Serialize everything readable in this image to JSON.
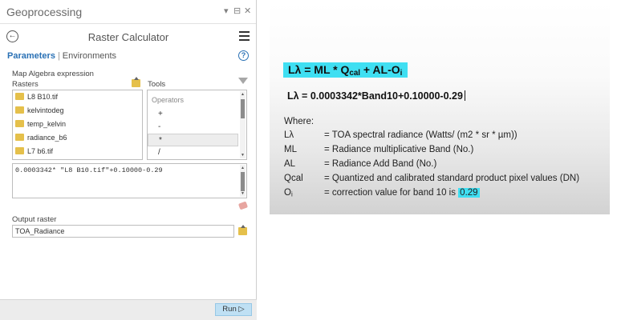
{
  "pane": {
    "title": "Geoprocessing",
    "header_icons": [
      "dropdown-icon",
      "pin-icon",
      "close-icon"
    ],
    "pin_glyph": "▾",
    "dock_glyph": "⊟",
    "close_glyph": "✕"
  },
  "tool": {
    "title": "Raster Calculator",
    "back_glyph": "←"
  },
  "tabs": {
    "parameters": "Parameters",
    "separator": "|",
    "environments": "Environments",
    "help_glyph": "?"
  },
  "map_algebra": {
    "section_label": "Map Algebra expression",
    "rasters_label": "Rasters",
    "tools_label": "Tools",
    "rasters": [
      "L8 B10.tif",
      "kelvintodeg",
      "temp_kelvin",
      "radiance_b6",
      "L7 b6.tif"
    ],
    "operators_label": "Operators",
    "operators": [
      "+",
      "-",
      "*",
      "/"
    ],
    "selected_operator": "*",
    "expression": "0.0003342* \"L8 B10.tif\"+0.10000-0.29"
  },
  "output": {
    "label": "Output raster",
    "value": "TOA_Radiance"
  },
  "run_label": "Run",
  "run_glyph": "▷",
  "formula": {
    "title": {
      "lhs": "Lλ = ML * Q",
      "sub": "cal",
      "rhs": " + AL-O",
      "rhs_sub": "i"
    },
    "main": "Lλ = 0.0003342*Band10+0.10000-0.29",
    "where": "Where:",
    "terms": [
      {
        "term": "Lλ",
        "desc": "= TOA spectral radiance (Watts/ (m2 * sr * µm))"
      },
      {
        "term": "ML",
        "desc": "= Radiance multiplicative Band (No.)"
      },
      {
        "term": "AL",
        "desc": "= Radiance Add Band (No.)"
      },
      {
        "term": "Qcal",
        "desc": "= Quantized and calibrated standard product pixel values (DN)"
      },
      {
        "term": "O",
        "term_sub": "i",
        "desc": "= correction value for band 10 is ",
        "value": "0.29"
      }
    ]
  },
  "colors": {
    "accent_blue": "#2a71b5",
    "highlight_cyan": "#3fdff2",
    "folder_yellow": "#e5c04b",
    "run_button": "#bfe0f4"
  }
}
